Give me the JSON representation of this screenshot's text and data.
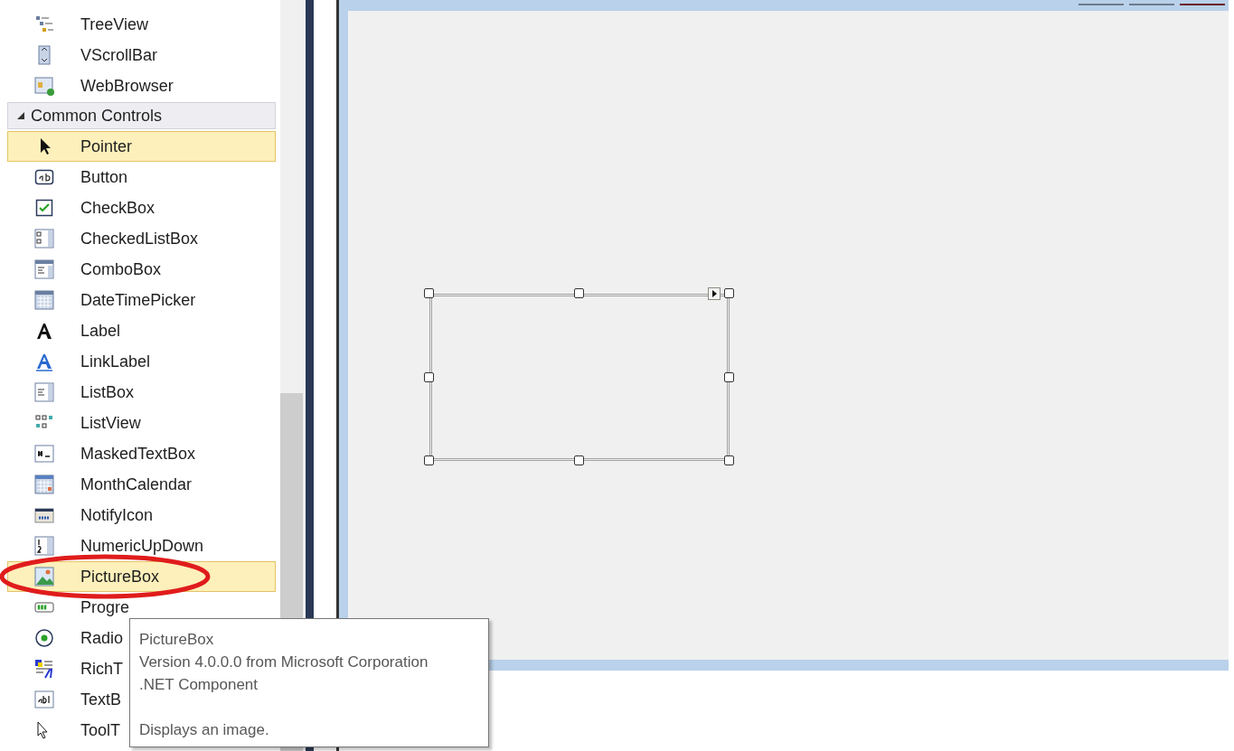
{
  "toolbox": {
    "items_above": [
      {
        "label": "TreeView",
        "kind": "treeview",
        "selected": false,
        "circled": false
      },
      {
        "label": "VScrollBar",
        "kind": "vscroll",
        "selected": false,
        "circled": false
      },
      {
        "label": "WebBrowser",
        "kind": "web",
        "selected": false,
        "circled": false
      }
    ],
    "groups": [
      {
        "title": "Common Controls",
        "expanded": true,
        "items": [
          {
            "label": "Pointer",
            "kind": "pointer",
            "selected": true,
            "circled": false
          },
          {
            "label": "Button",
            "kind": "button",
            "selected": false,
            "circled": false
          },
          {
            "label": "CheckBox",
            "kind": "checkbox",
            "selected": false,
            "circled": false
          },
          {
            "label": "CheckedListBox",
            "kind": "checkedlist",
            "selected": false,
            "circled": false
          },
          {
            "label": "ComboBox",
            "kind": "combo",
            "selected": false,
            "circled": false
          },
          {
            "label": "DateTimePicker",
            "kind": "datetime",
            "selected": false,
            "circled": false
          },
          {
            "label": "Label",
            "kind": "label",
            "selected": false,
            "circled": false
          },
          {
            "label": "LinkLabel",
            "kind": "linklabel",
            "selected": false,
            "circled": false
          },
          {
            "label": "ListBox",
            "kind": "listbox",
            "selected": false,
            "circled": false
          },
          {
            "label": "ListView",
            "kind": "listview",
            "selected": false,
            "circled": false
          },
          {
            "label": "MaskedTextBox",
            "kind": "masked",
            "selected": false,
            "circled": false
          },
          {
            "label": "MonthCalendar",
            "kind": "calendar",
            "selected": false,
            "circled": false
          },
          {
            "label": "NotifyIcon",
            "kind": "notify",
            "selected": false,
            "circled": false
          },
          {
            "label": "NumericUpDown",
            "kind": "numeric",
            "selected": false,
            "circled": false
          },
          {
            "label": "PictureBox",
            "kind": "picture",
            "selected": true,
            "circled": true
          },
          {
            "label": "Progre",
            "kind": "progress",
            "selected": false,
            "circled": false
          },
          {
            "label": "Radio",
            "kind": "radio",
            "selected": false,
            "circled": false
          },
          {
            "label": "RichT",
            "kind": "richtext",
            "selected": false,
            "circled": false
          },
          {
            "label": "TextB",
            "kind": "textbox",
            "selected": false,
            "circled": false
          },
          {
            "label": "ToolT",
            "kind": "tooltip",
            "selected": false,
            "circled": false
          }
        ]
      }
    ]
  },
  "tooltip": {
    "title": "PictureBox",
    "lines": [
      "Version 4.0.0.0 from Microsoft Corporation",
      ".NET Component"
    ],
    "description": "Displays an image."
  },
  "designer": {
    "control": {
      "selected": true
    }
  }
}
